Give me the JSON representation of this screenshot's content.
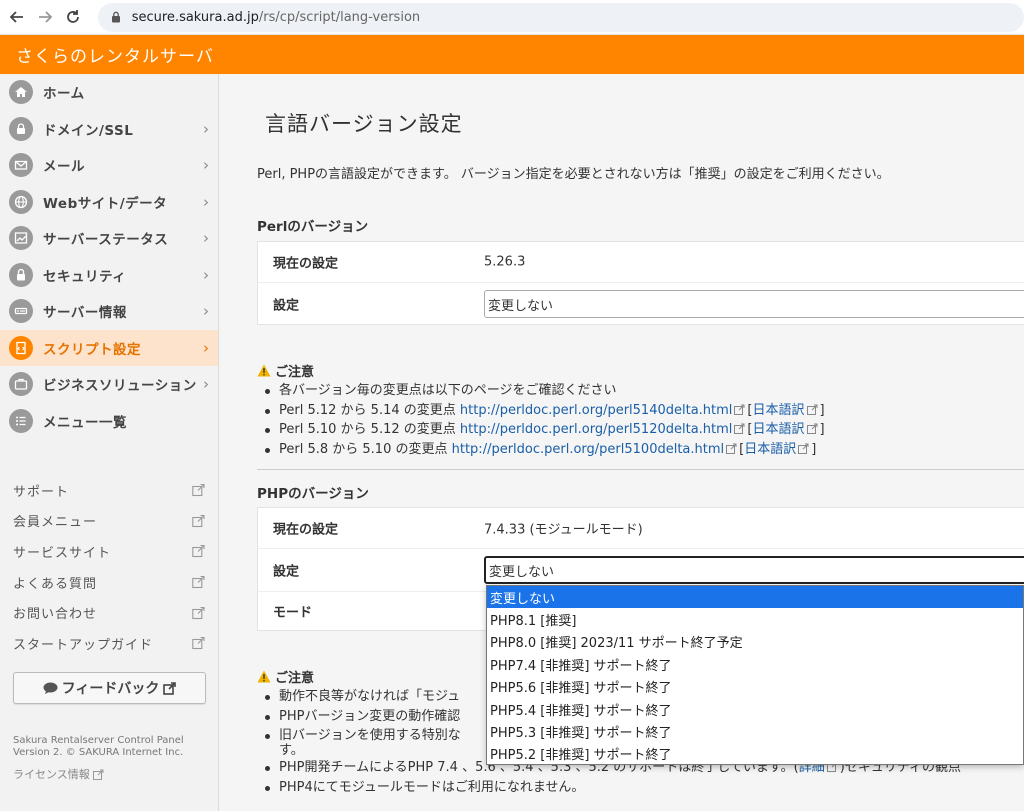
{
  "browser": {
    "url_domain": "secure.sakura.ad.jp",
    "url_path": "/rs/cp/script/lang-version"
  },
  "header": {
    "title": "さくらのレンタルサーバ"
  },
  "sidebar": {
    "items": [
      {
        "label": "ホーム",
        "icon": "home-icon",
        "chevron": false
      },
      {
        "label": "ドメイン/SSL",
        "icon": "lock-icon",
        "chevron": true
      },
      {
        "label": "メール",
        "icon": "mail-icon",
        "chevron": true
      },
      {
        "label": "Webサイト/データ",
        "icon": "globe-icon",
        "chevron": true
      },
      {
        "label": "サーバーステータス",
        "icon": "chart-icon",
        "chevron": true
      },
      {
        "label": "セキュリティ",
        "icon": "padlock-icon",
        "chevron": true
      },
      {
        "label": "サーバー情報",
        "icon": "server-icon",
        "chevron": true
      },
      {
        "label": "スクリプト設定",
        "icon": "script-icon",
        "chevron": true,
        "active": true
      },
      {
        "label": "ビジネスソリューション",
        "icon": "briefcase-icon",
        "chevron": true
      },
      {
        "label": "メニュー一覧",
        "icon": "list-icon",
        "chevron": false
      }
    ],
    "external_links": [
      "サポート",
      "会員メニュー",
      "サービスサイト",
      "よくある質問",
      "お問い合わせ",
      "スタートアップガイド"
    ],
    "feedback_label": "フィードバック",
    "copyright_line1": "Sakura Rentalserver Control Panel",
    "copyright_line2": "Version 2. © SAKURA Internet Inc.",
    "license_label": "ライセンス情報"
  },
  "main": {
    "title": "言語バージョン設定",
    "intro": "Perl, PHPの言語設定ができます。 バージョン指定を必要とされない方は「推奨」の設定をご利用ください。",
    "perl": {
      "heading": "Perlのバージョン",
      "current_label": "現在の設定",
      "current_value": "5.26.3",
      "setting_label": "設定",
      "setting_value": "変更しない",
      "notice_title": "ご注意",
      "notice_intro": "各バージョン毎の変更点は以下のページをご確認ください",
      "links": [
        {
          "text": "Perl 5.12 から 5.14 の変更点 ",
          "url": "http://perldoc.perl.org/perl5140delta.html",
          "jp": "日本語訳"
        },
        {
          "text": "Perl 5.10 から 5.12 の変更点 ",
          "url": "http://perldoc.perl.org/perl5120delta.html",
          "jp": "日本語訳"
        },
        {
          "text": "Perl 5.8 から 5.10 の変更点 ",
          "url": "http://perldoc.perl.org/perl5100delta.html",
          "jp": "日本語訳"
        }
      ]
    },
    "php": {
      "heading": "PHPのバージョン",
      "current_label": "現在の設定",
      "current_value": "7.4.33 (モジュールモード)",
      "setting_label": "設定",
      "setting_value": "変更しない",
      "mode_label": "モード",
      "notice_title": "ご注意",
      "notes": [
        "動作不良等がなければ「モジュ",
        "PHPバージョン変更の動作確認",
        "旧バージョンを使用する特別な",
        "す。",
        "PHP開発チームによるPHP 7.4 、5.6 、5.4 、5.3 、5.2 のサポートは終了しています。(",
        "PHP4にてモジュールモードはご利用になれません。"
      ],
      "note5_link": "詳細",
      "note5_tail": ")セキュリティの観点",
      "dropdown_options": [
        "変更しない",
        "PHP8.1 [推奨]",
        "PHP8.0 [推奨] 2023/11 サポート終了予定",
        "PHP7.4 [非推奨] サポート終了",
        "PHP5.6 [非推奨] サポート終了",
        "PHP5.4 [非推奨] サポート終了",
        "PHP5.3 [非推奨] サポート終了",
        "PHP5.2 [非推奨] サポート終了"
      ]
    }
  },
  "colors": {
    "brand": "#ff8400",
    "active_bg": "#fde3cb",
    "link": "#1a5fa8",
    "highlight": "#1a73e8"
  }
}
